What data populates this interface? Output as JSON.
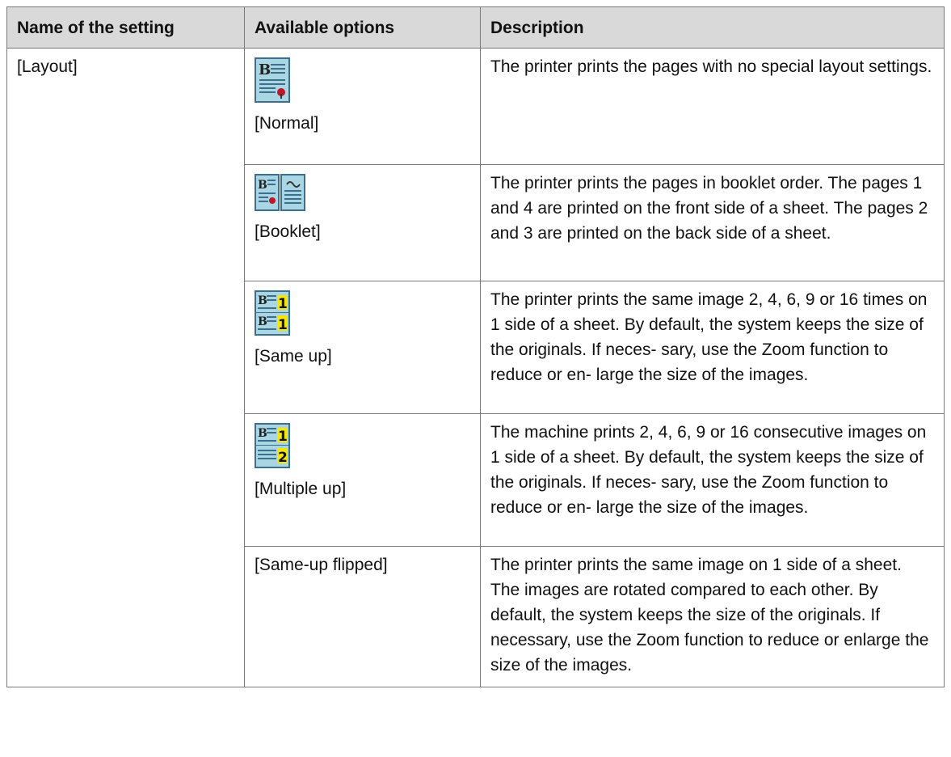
{
  "table": {
    "headers": {
      "name": "Name of the setting",
      "options": "Available options",
      "description": "Description"
    },
    "setting_name": "[Layout]",
    "rows": [
      {
        "option_label": "[Normal]",
        "icon": "normal-layout-icon",
        "description": "The printer prints the pages with no special layout settings."
      },
      {
        "option_label": "[Booklet]",
        "icon": "booklet-layout-icon",
        "description": "The printer prints the pages in booklet order. The pages 1 and 4 are printed on the front side of a sheet. The pages 2 and 3 are printed on the back side of a sheet."
      },
      {
        "option_label": "[Same up]",
        "icon": "same-up-layout-icon",
        "description": "The printer prints the same image 2, 4, 6, 9 or 16 times on 1 side of a sheet. By default, the system keeps the size of the originals. If neces- sary, use the Zoom function to reduce or en- large the size of the images."
      },
      {
        "option_label": "[Multiple up]",
        "icon": "multiple-up-layout-icon",
        "description": "The machine prints 2, 4, 6, 9 or 16 consecutive images on 1 side of a sheet. By default, the system keeps the size of the originals. If neces- sary, use the Zoom function to reduce or en- large the size of the images."
      },
      {
        "option_label": "[Same-up flipped]",
        "icon": "",
        "description": "The printer prints the same image on 1 side of a sheet. The images are rotated compared to each other. By default, the system keeps the size of the originals. If necessary, use the Zoom function to reduce or enlarge the size of the images."
      }
    ],
    "colors": {
      "header_bg": "#d9d9d9",
      "border": "#7a7a7a",
      "icon_page_bg": "#a9d6e2",
      "icon_badge_yellow": "#f5e600"
    }
  }
}
